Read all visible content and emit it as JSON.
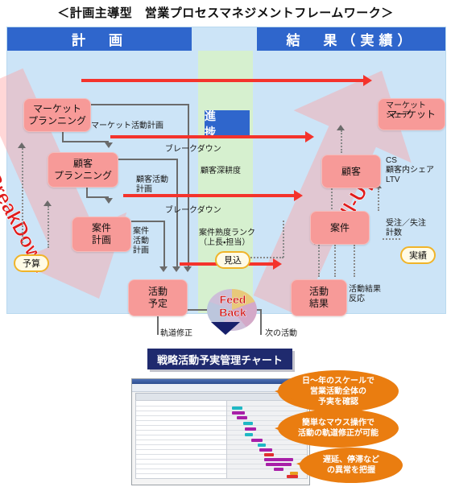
{
  "doc": {
    "title": "＜計画主導型　営業プロセスマネジメントフレームワーク＞"
  },
  "framework": {
    "headers": {
      "plan": "計　画",
      "result": "結　果（実績）"
    },
    "center": {
      "progress_label": "進　捗",
      "customer_depth": "顧客深耕度",
      "case_rank": "案件熟度ランク\n（上長・担当）",
      "forecast_badge": "見込",
      "feedback_line1": "Feed",
      "feedback_line2": "Back"
    },
    "band_words": {
      "breakdown": "BreakDown",
      "rollup": "Roll-Up"
    },
    "plan_boxes": [
      {
        "id": "market-planning",
        "line1": "マーケット",
        "line2": "プランニング"
      },
      {
        "id": "customer-planning",
        "line1": "顧客",
        "line2": "プランニング"
      },
      {
        "id": "case-plan",
        "line1": "案件",
        "line2": "計画"
      },
      {
        "id": "activity-plan",
        "line1": "活動",
        "line2": "予定"
      }
    ],
    "result_boxes": [
      {
        "id": "market-result",
        "line1": "マーケット",
        "line2": ""
      },
      {
        "id": "customer-result",
        "line1": "顧客",
        "line2": ""
      },
      {
        "id": "case-result",
        "line1": "案件",
        "line2": ""
      },
      {
        "id": "activity-result",
        "line1": "活動",
        "line2": "結果"
      }
    ],
    "annotations": {
      "market_activity_plan": "マーケット活動計画",
      "breakdown_1": "ブレークダウン",
      "customer_activity_plan": "顧客活動\n計画",
      "breakdown_2": "ブレークダウン",
      "case_activity_plan": "案件\n活動\n計画",
      "orbit_correction": "軌道修正",
      "next_activity": "次の活動",
      "market_share": "マーケット\nシェア",
      "cs_metrics": "CS\n顧客内シェア\nLTV",
      "order_loss": "受注／失注\n計数",
      "activity_reaction": "活動結果\n反応"
    },
    "badges": {
      "budget": "予算",
      "actual": "実績"
    }
  },
  "chart_section": {
    "title": "戦略活動予実管理チャート",
    "callouts": [
      "日～年のスケールで\n営業活動全体の\n予実を確認",
      "簡単なマウス操作で\n活動の軌道修正が可能",
      "遅延、停滞など\nの異常を把握"
    ]
  },
  "colors": {
    "header_blue": "#2f66cc",
    "panel_bg": "#cce4f7",
    "center_green": "#d6f0cf",
    "box_pink": "#f79a98",
    "band_pink": "#ffa0a0",
    "accent_red": "#f4332c",
    "navy": "#1f2a6e",
    "callout_orange": "#ea7d10",
    "badge_yellow": "#f0b429"
  }
}
